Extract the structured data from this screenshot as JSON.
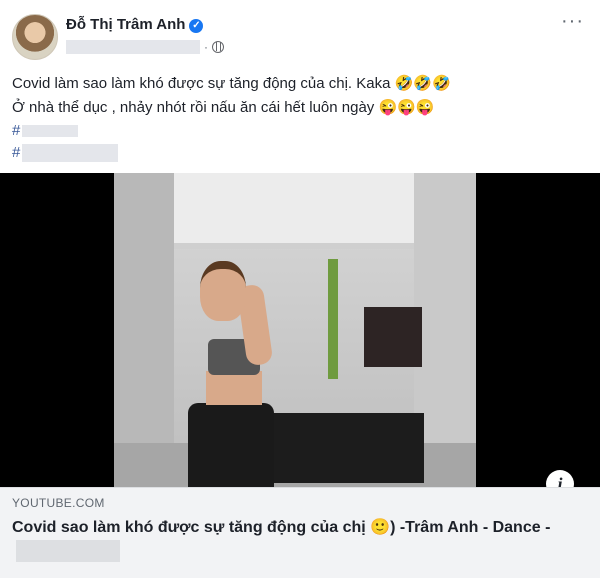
{
  "author": {
    "name": "Đỗ Thị Trâm Anh",
    "verified_mark": "✓"
  },
  "meta": {
    "dot": "·",
    "privacy_icon": "globe-icon"
  },
  "menu_label": "···",
  "post_text": {
    "line1": "Covid làm sao làm khó được sự tăng động của chị. Kaka 🤣🤣🤣",
    "line2": "Ở nhà thể dục , nhảy nhót rồi nấu ăn cái hết luôn ngày 😜😜😜",
    "hashtag1_prefix": "#",
    "hashtag2_prefix": "#"
  },
  "link_preview": {
    "domain": "YOUTUBE.COM",
    "title": "Covid sao làm khó được sự tăng động của chị 🙂) -Trâm Anh - Dance -",
    "info_label": "i"
  },
  "colors": {
    "verified": "#1877f2",
    "link_bg": "#f2f3f5",
    "hashtag": "#385898"
  }
}
